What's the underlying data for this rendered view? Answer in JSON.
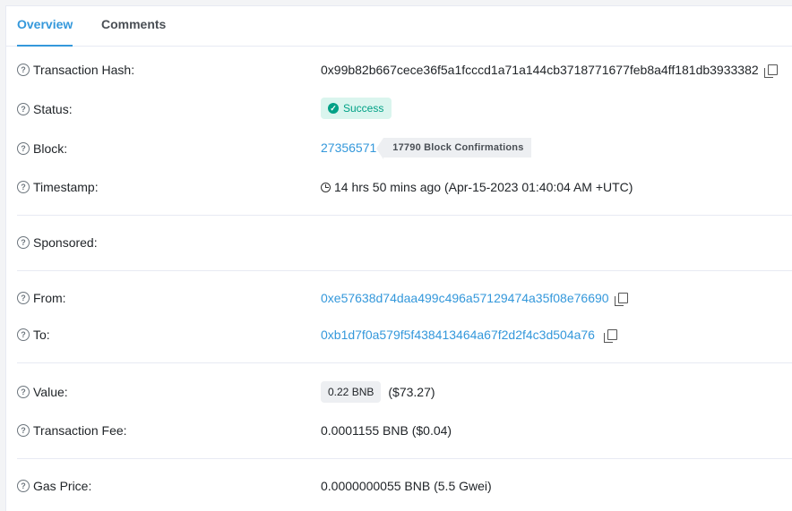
{
  "tabs": [
    {
      "label": "Overview"
    },
    {
      "label": "Comments"
    }
  ],
  "details": {
    "tx_hash": {
      "label": "Transaction Hash:",
      "value": "0x99b82b667cece36f5a1fcccd1a71a144cb3718771677feb8a4ff181db3933382"
    },
    "status": {
      "label": "Status:",
      "value": "Success"
    },
    "block": {
      "label": "Block:",
      "value": "27356571",
      "confirmations": "17790 Block Confirmations"
    },
    "timestamp": {
      "label": "Timestamp:",
      "value": "14 hrs 50 mins ago (Apr-15-2023 01:40:04 AM +UTC)"
    },
    "sponsored": {
      "label": "Sponsored:"
    },
    "from": {
      "label": "From:",
      "value": "0xe57638d74daa499c496a57129474a35f08e76690"
    },
    "to": {
      "label": "To:",
      "value": "0xb1d7f0a579f5f438413464a67f2d2f4c3d504a76"
    },
    "value": {
      "label": "Value:",
      "amount": "0.22 BNB",
      "usd": "($73.27)"
    },
    "fee": {
      "label": "Transaction Fee:",
      "value": "0.0001155 BNB ($0.04)"
    },
    "gas": {
      "label": "Gas Price:",
      "value": "0.0000000055 BNB (5.5 Gwei)"
    }
  },
  "icons": {
    "help": "question-circle-icon",
    "copy": "copy-icon",
    "check": "check-circle-icon",
    "clock": "clock-icon"
  },
  "colors": {
    "link": "#3498db",
    "success_bg": "#daf5ee",
    "success_text": "#00a186"
  }
}
